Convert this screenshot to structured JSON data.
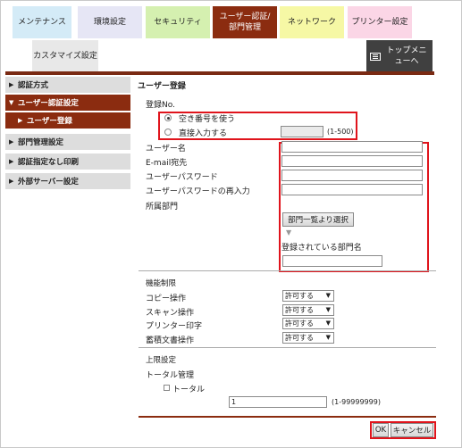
{
  "tabs": [
    {
      "label": "メンテナンス",
      "bg": "#d4ebf7",
      "color": "#222"
    },
    {
      "label": "環境設定",
      "bg": "#e6e6f5",
      "color": "#222"
    },
    {
      "label": "セキュリティ",
      "bg": "#d5f0b0",
      "color": "#222"
    },
    {
      "label": "ユーザー認証/部門管理",
      "bg": "#8b2c10",
      "color": "#fff"
    },
    {
      "label": "ネットワーク",
      "bg": "#f6f8a5",
      "color": "#222"
    },
    {
      "label": "プリンター設定",
      "bg": "#fbd6e6",
      "color": "#222"
    },
    {
      "label": "カスタマイズ設定",
      "bg": "#e8e8e8",
      "color": "#222"
    }
  ],
  "top_menu_label": "トップメニューへ",
  "sidebar": {
    "items": [
      {
        "label": "認証方式",
        "active": false
      },
      {
        "label": "ユーザー認証設定",
        "active": true
      },
      {
        "label": "ユーザー登録",
        "active": true
      },
      {
        "label": "部門管理設定",
        "active": false
      },
      {
        "label": "認証指定なし印刷",
        "active": false
      },
      {
        "label": "外部サーバー設定",
        "active": false
      }
    ]
  },
  "form": {
    "title": "ユーザー登録",
    "reg_no_label": "登録No.",
    "radio_free": "空き番号を使う",
    "radio_direct": "直接入力する",
    "range_hint": "(1-500)",
    "username_label": "ユーザー名",
    "email_label": "E-mail宛先",
    "password_label": "ユーザーパスワード",
    "password_confirm_label": "ユーザーパスワードの再入力",
    "dept_label": "所属部門",
    "dept_select_button": "部門一覧より選択",
    "registered_dept_label": "登録されている部門名",
    "function_limit_title": "機能制限",
    "copy_label": "コピー操作",
    "scan_label": "スキャン操作",
    "print_label": "プリンター印字",
    "storage_label": "蓄積文書操作",
    "permit_value": "許可する",
    "upper_limit_title": "上限設定",
    "total_mgmt_label": "トータル管理",
    "total_checkbox_label": "トータル",
    "total_value": "1",
    "total_range_hint": "(1-99999999)",
    "ok_button": "OK",
    "cancel_button": "キャンセル"
  },
  "colors": {
    "accent": "#8b2c10",
    "highlight": "#e0141c"
  }
}
